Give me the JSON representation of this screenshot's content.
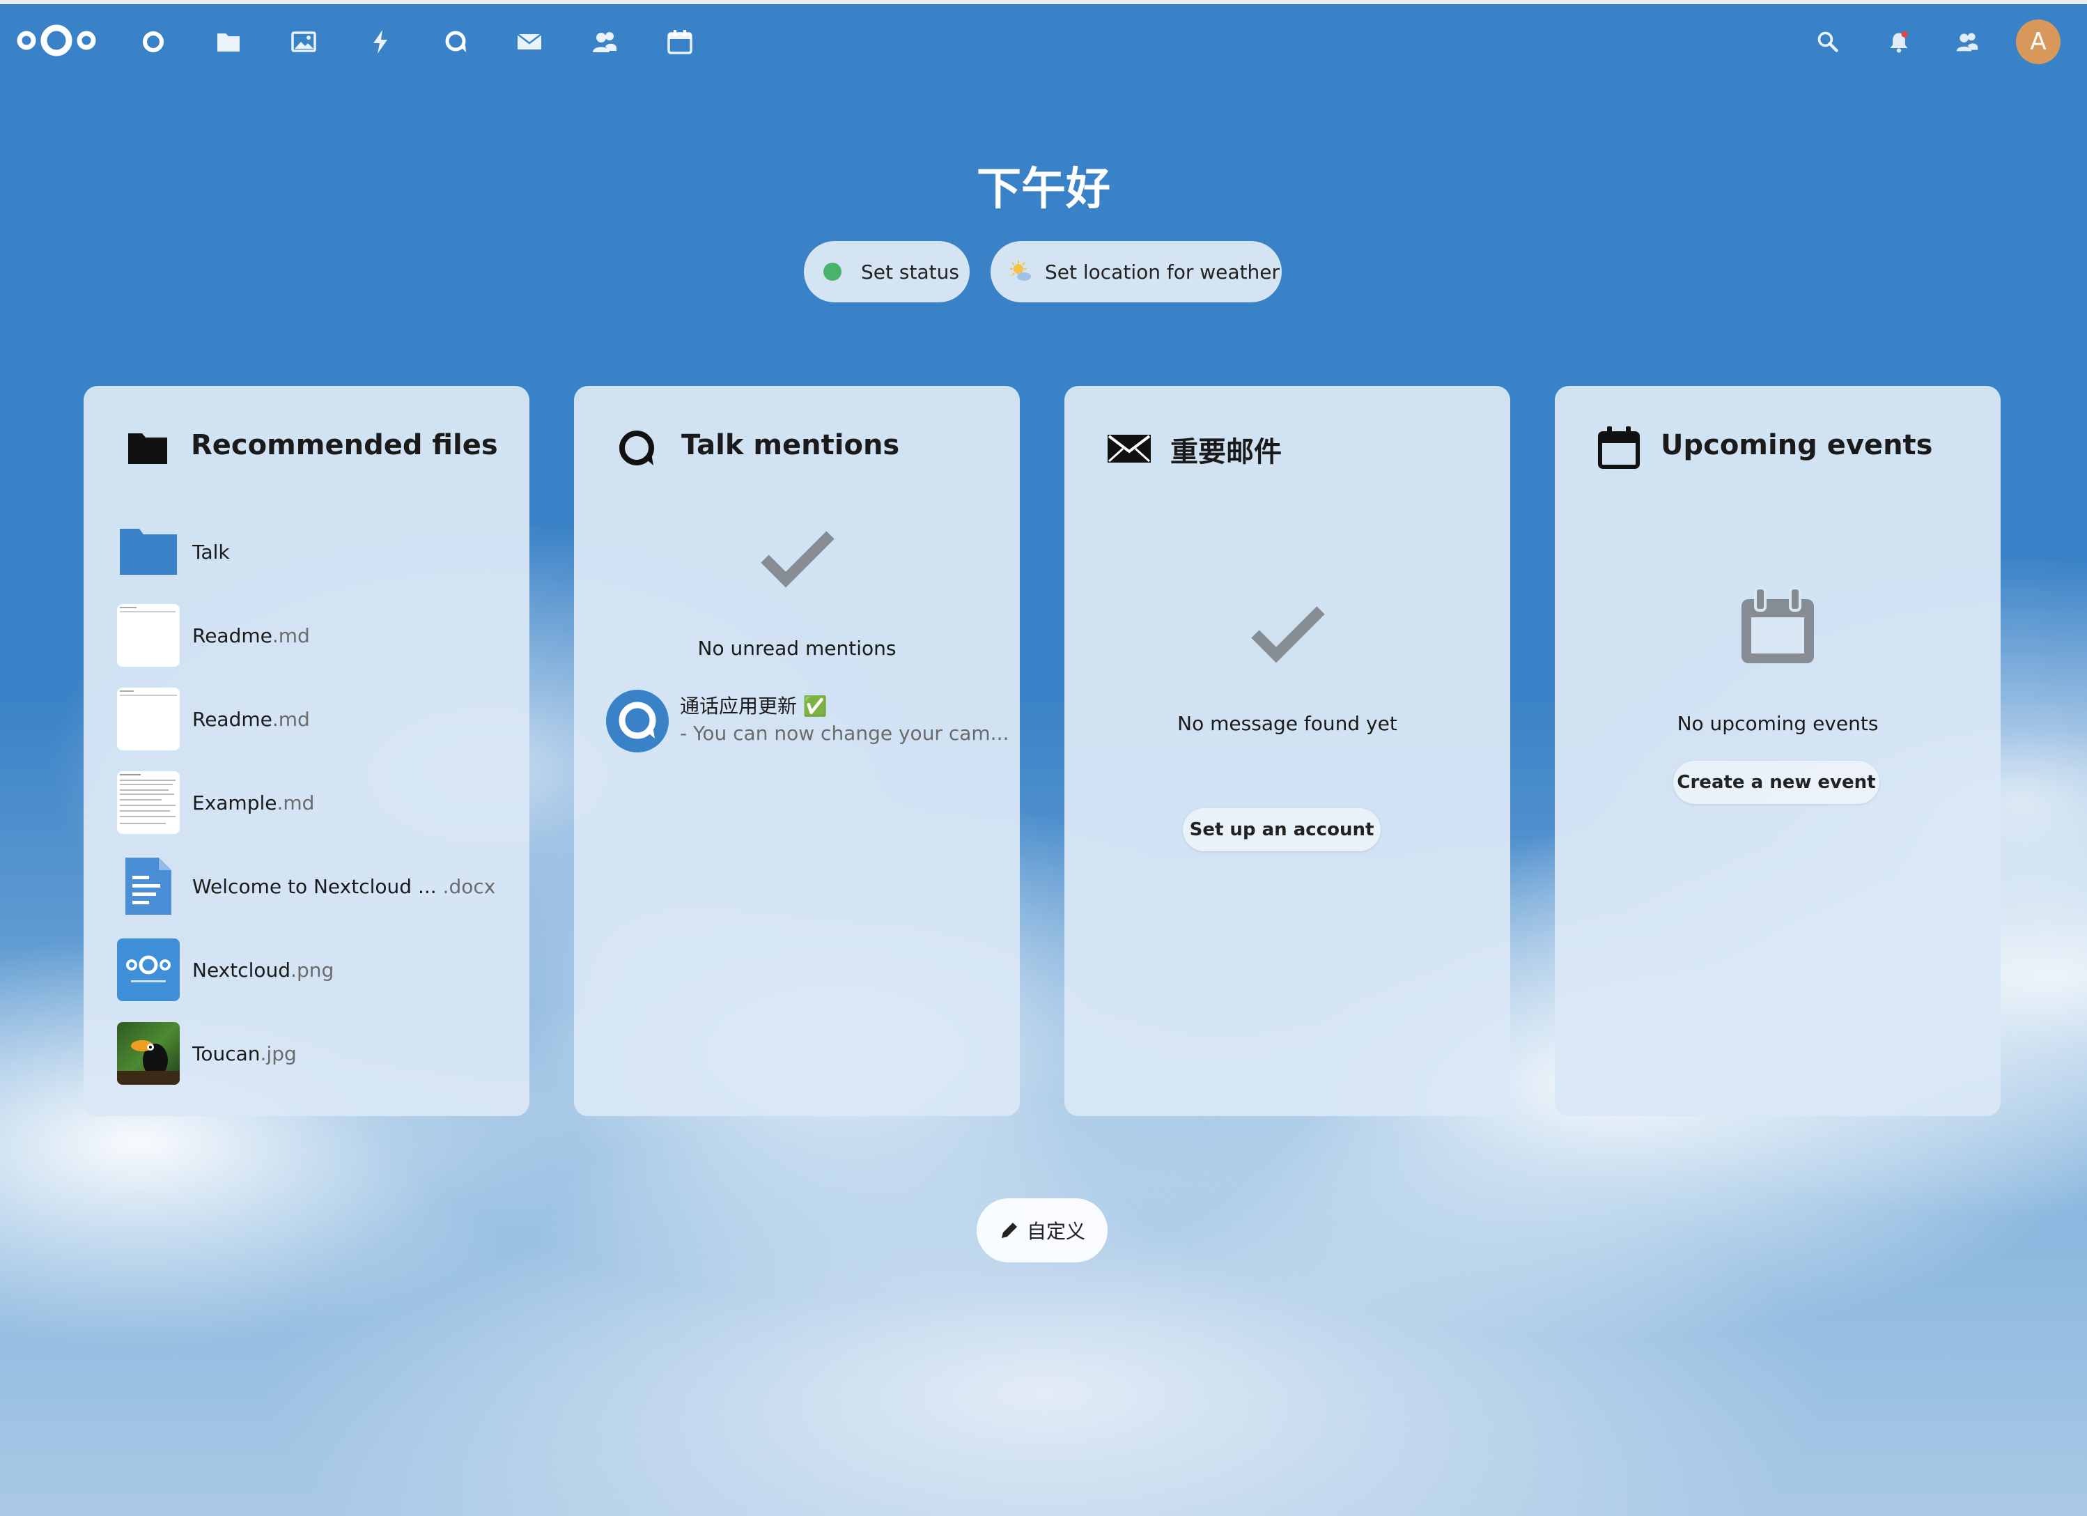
{
  "header": {
    "apps": [
      {
        "name": "dashboard-icon"
      },
      {
        "name": "files-icon"
      },
      {
        "name": "photos-icon"
      },
      {
        "name": "activity-icon"
      },
      {
        "name": "talk-icon"
      },
      {
        "name": "mail-icon"
      },
      {
        "name": "contacts-icon"
      },
      {
        "name": "calendar-icon"
      }
    ],
    "right_icons": [
      "search-icon",
      "notifications-icon",
      "contacts-menu-icon"
    ],
    "avatar_letter": "A",
    "avatar_color": "#d9985b"
  },
  "greeting": "下午好",
  "status": {
    "set_status_label": "Set status",
    "status_color": "#49b36a",
    "weather_label": "Set location for weather"
  },
  "widgets": {
    "files": {
      "title": "Recommended files",
      "items": [
        {
          "name": "Talk",
          "ext": "",
          "kind": "folder"
        },
        {
          "name": "Readme",
          "ext": ".md",
          "kind": "text"
        },
        {
          "name": "Readme",
          "ext": ".md",
          "kind": "text"
        },
        {
          "name": "Example",
          "ext": ".md",
          "kind": "text"
        },
        {
          "name": "Welcome to Nextcloud ...",
          "ext": " .docx",
          "kind": "document"
        },
        {
          "name": "Nextcloud",
          "ext": ".png",
          "kind": "nextcloud-image"
        },
        {
          "name": "Toucan",
          "ext": ".jpg",
          "kind": "photo"
        }
      ]
    },
    "talk": {
      "title": "Talk mentions",
      "empty_text": "No unread mentions",
      "item_title": "通话应用更新 ✅",
      "item_subtitle": "- You can now change your cam..."
    },
    "mail": {
      "title": "重要邮件",
      "empty_text": "No message found yet",
      "button": "Set up an account"
    },
    "calendar": {
      "title": "Upcoming events",
      "empty_text": "No upcoming events",
      "button": "Create a new event"
    }
  },
  "customize_label": "自定义",
  "colors": {
    "primary": "#3a82c7",
    "card": "#d9e7f5"
  }
}
